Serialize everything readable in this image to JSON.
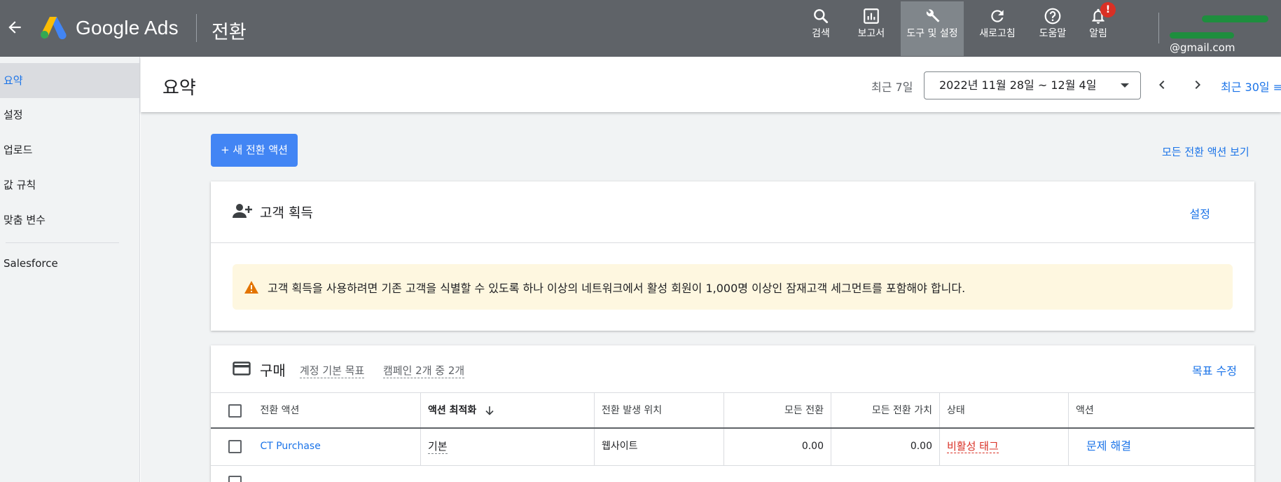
{
  "topbar": {
    "brand": "Google Ads",
    "section": "전환",
    "tools": [
      {
        "label": "검색",
        "icon": "search-icon"
      },
      {
        "label": "보고서",
        "icon": "reports-icon"
      },
      {
        "label": "도구 및 설정",
        "icon": "wrench-icon"
      },
      {
        "label": "새로고침",
        "icon": "refresh-icon"
      },
      {
        "label": "도움말",
        "icon": "help-icon"
      },
      {
        "label": "알림",
        "icon": "bell-icon"
      }
    ],
    "notification_badge": "!",
    "account_email_suffix": "@gmail.com"
  },
  "sidebar": {
    "items": [
      {
        "label": "요약"
      },
      {
        "label": "설정"
      },
      {
        "label": "업로드"
      },
      {
        "label": "값 규칙"
      },
      {
        "label": "맞춤 변수"
      },
      {
        "label": "Salesforce"
      }
    ]
  },
  "header": {
    "title": "요약",
    "range_label": "최근 7일",
    "range_value": "2022년 11월 28일 ~ 12월 4일",
    "compare_link": "최근 30일 ≡"
  },
  "main": {
    "new_action_button": "+ 새 전환 액션",
    "all_actions_link": "모든 전환 액션 보기",
    "acquisition": {
      "title": "고객 획득",
      "settings_link": "설정",
      "notice": "고객 획득을 사용하려면 기존 고객을 식별할 수 있도록 하나 이상의 네트워크에서 활성 회원이 1,000명 이상인 잠재고객 세그먼트를 포함해야 합니다."
    },
    "purchase": {
      "title": "구매",
      "sub1": "계정 기본 목표",
      "sub2": "캠페인 2개 중 2개",
      "edit_goal_link": "목표 수정",
      "columns": [
        "전환 액션",
        "액션 최적화",
        "전환 발생 위치",
        "모든 전환",
        "모든 전환 가치",
        "상태",
        "액션"
      ],
      "rows": [
        {
          "action": "CT Purchase",
          "optimization": "기본",
          "source": "웹사이트",
          "all_conv": "0.00",
          "all_conv_value": "0.00",
          "status": "비활성 태그",
          "fix": "문제 해결"
        }
      ]
    }
  },
  "colors": {
    "topbar": "#5f6368",
    "accent": "#1a73e8",
    "primary_button": "#4285f4",
    "warning_bg": "#fef7e0",
    "warning_icon": "#e37400",
    "error": "#d93025"
  }
}
